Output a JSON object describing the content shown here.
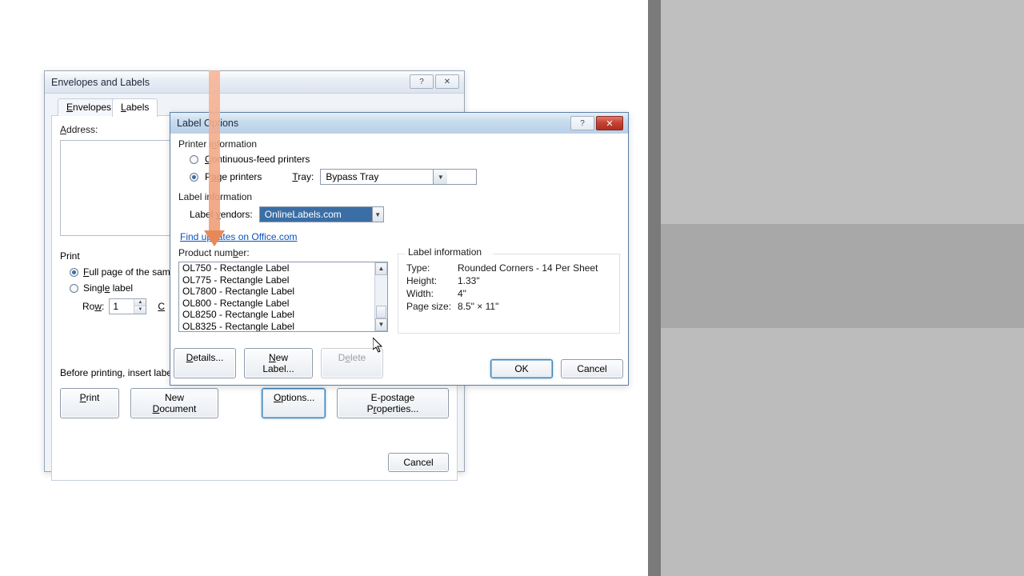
{
  "envl_dialog": {
    "title": "Envelopes and Labels",
    "help_btn_icon": "?",
    "close_btn_icon": "✕",
    "tabs": {
      "envelopes": "Envelopes",
      "labels": "Labels"
    },
    "address_label": "Address:",
    "print_label": "Print",
    "radio_full": "Full page of the sam",
    "radio_single": "Single label",
    "row_label": "Row:",
    "row_value": "1",
    "col_symbol": "C",
    "hint": "Before printing, insert labels in your printer's manual feeder.",
    "buttons": {
      "print": "Print",
      "new_doc": "New Document",
      "options": "Options...",
      "epostage": "E-postage Properties...",
      "cancel": "Cancel"
    }
  },
  "options_dialog": {
    "title": "Label Options",
    "help_btn_icon": "?",
    "close_btn_icon": "✕",
    "printer_section": "Printer information",
    "radio_continuous": "Continuous-feed printers",
    "radio_page": "Page printers",
    "tray_label": "Tray:",
    "tray_value": "Bypass Tray",
    "label_section": "Label information",
    "vendors_label": "Label vendors:",
    "vendors_value": "OnlineLabels.com",
    "update_link": "Find updates on Office.com",
    "product_label": "Product number:",
    "product_items": [
      "OL750 - Rectangle Label",
      "OL775 - Rectangle Label",
      "OL7800 - Rectangle Label",
      "OL800 - Rectangle Label",
      "OL8250 - Rectangle Label",
      "OL8325 - Rectangle Label"
    ],
    "info_section": "Label information",
    "info": {
      "type_key": "Type:",
      "type_val": "Rounded Corners - 14 Per Sheet",
      "height_key": "Height:",
      "height_val": "1.33\"",
      "width_key": "Width:",
      "width_val": "4\"",
      "pagesize_key": "Page size:",
      "pagesize_val": "8.5\" × 11\""
    },
    "buttons": {
      "details": "Details...",
      "new_label": "New Label...",
      "delete": "Delete",
      "ok": "OK",
      "cancel": "Cancel"
    }
  }
}
